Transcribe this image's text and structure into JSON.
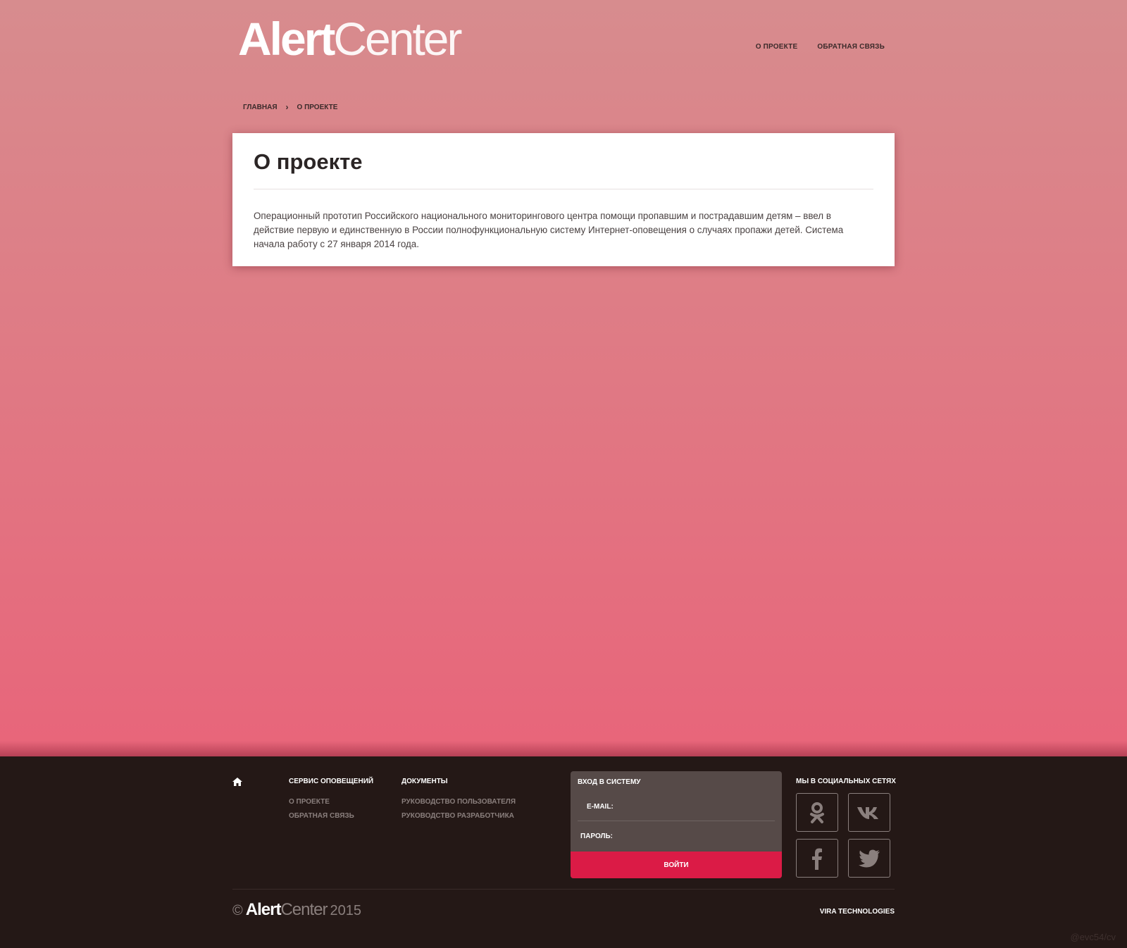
{
  "header": {
    "logo_bold": "Alert",
    "logo_light": "Center",
    "nav": [
      {
        "label": "О ПРОЕКТЕ"
      },
      {
        "label": "ОБРАТНАЯ СВЯЗЬ"
      }
    ]
  },
  "breadcrumb": {
    "home": "ГЛАВНАЯ",
    "separator": "›",
    "current": "О ПРОЕКТЕ"
  },
  "content": {
    "title": "О проекте",
    "body": "Операционный прототип Российского национального мониторингового центра помощи пропавшим и пострадавшим детям – ввел в действие первую и единственную в России полнофункциональную систему Интернет-оповещения о случаях пропажи детей. Система начала работу с 27 января 2014 года."
  },
  "footer": {
    "home_icon": "home-icon",
    "columns": [
      {
        "title": "СЕРВИС ОПОВЕЩЕНИЙ",
        "links": [
          "О ПРОЕКТЕ",
          "ОБРАТНАЯ СВЯЗЬ"
        ]
      },
      {
        "title": "ДОКУМЕНТЫ",
        "links": [
          "РУКОВОДСТВО ПОЛЬЗОВАТЕЛЯ",
          "РУКОВОДСТВО РАЗРАБОТЧИКА"
        ]
      }
    ],
    "login": {
      "title": "ВХОД В СИСТЕМУ",
      "email_label": "E-MAIL:",
      "password_label": "ПАРОЛЬ:",
      "submit_label": "ВОЙТИ"
    },
    "social": {
      "title": "МЫ В СОЦИАЛЬНЫХ СЕТЯХ",
      "icons": [
        "odnoklassniki-icon",
        "vk-icon",
        "facebook-icon",
        "twitter-icon"
      ]
    },
    "copyright": {
      "symbol": "©",
      "brand_bold": "Alert",
      "brand_light": "Center",
      "year": "2015"
    },
    "vendor": "VIRA TECHNOLOGIES"
  },
  "watermark": "@evc54/cv",
  "colors": {
    "accent": "#db1b46",
    "footer_bg": "#241816",
    "login_bg": "#564a48",
    "hero_top": "#d78c8e",
    "hero_bottom": "#e8657a"
  }
}
